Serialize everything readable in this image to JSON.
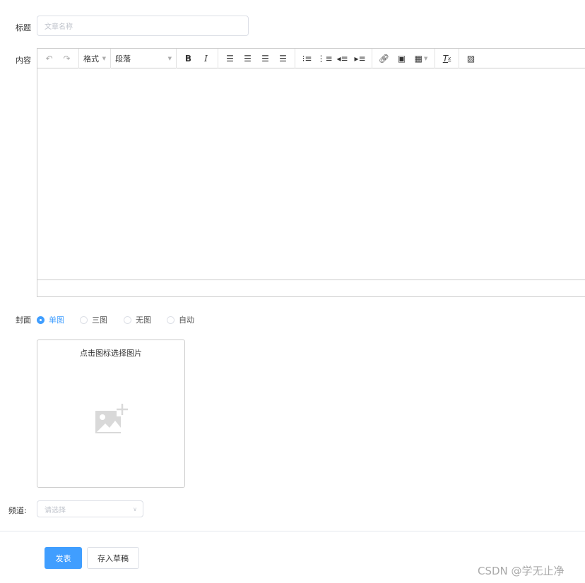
{
  "form": {
    "title_label": "标题",
    "title_placeholder": "文章名称",
    "content_label": "内容",
    "cover_label": "封面",
    "cover_options": [
      "单图",
      "三图",
      "无图",
      "自动"
    ],
    "cover_selected": "单图",
    "cover_hint": "点击图标选择图片",
    "channel_label": "频道:",
    "channel_placeholder": "请选择",
    "publish": "发表",
    "draft": "存入草稿"
  },
  "toolbar": {
    "format": "格式",
    "block": "段落"
  },
  "watermark": "CSDN @学无止净",
  "colors": {
    "primary": "#409eff"
  }
}
